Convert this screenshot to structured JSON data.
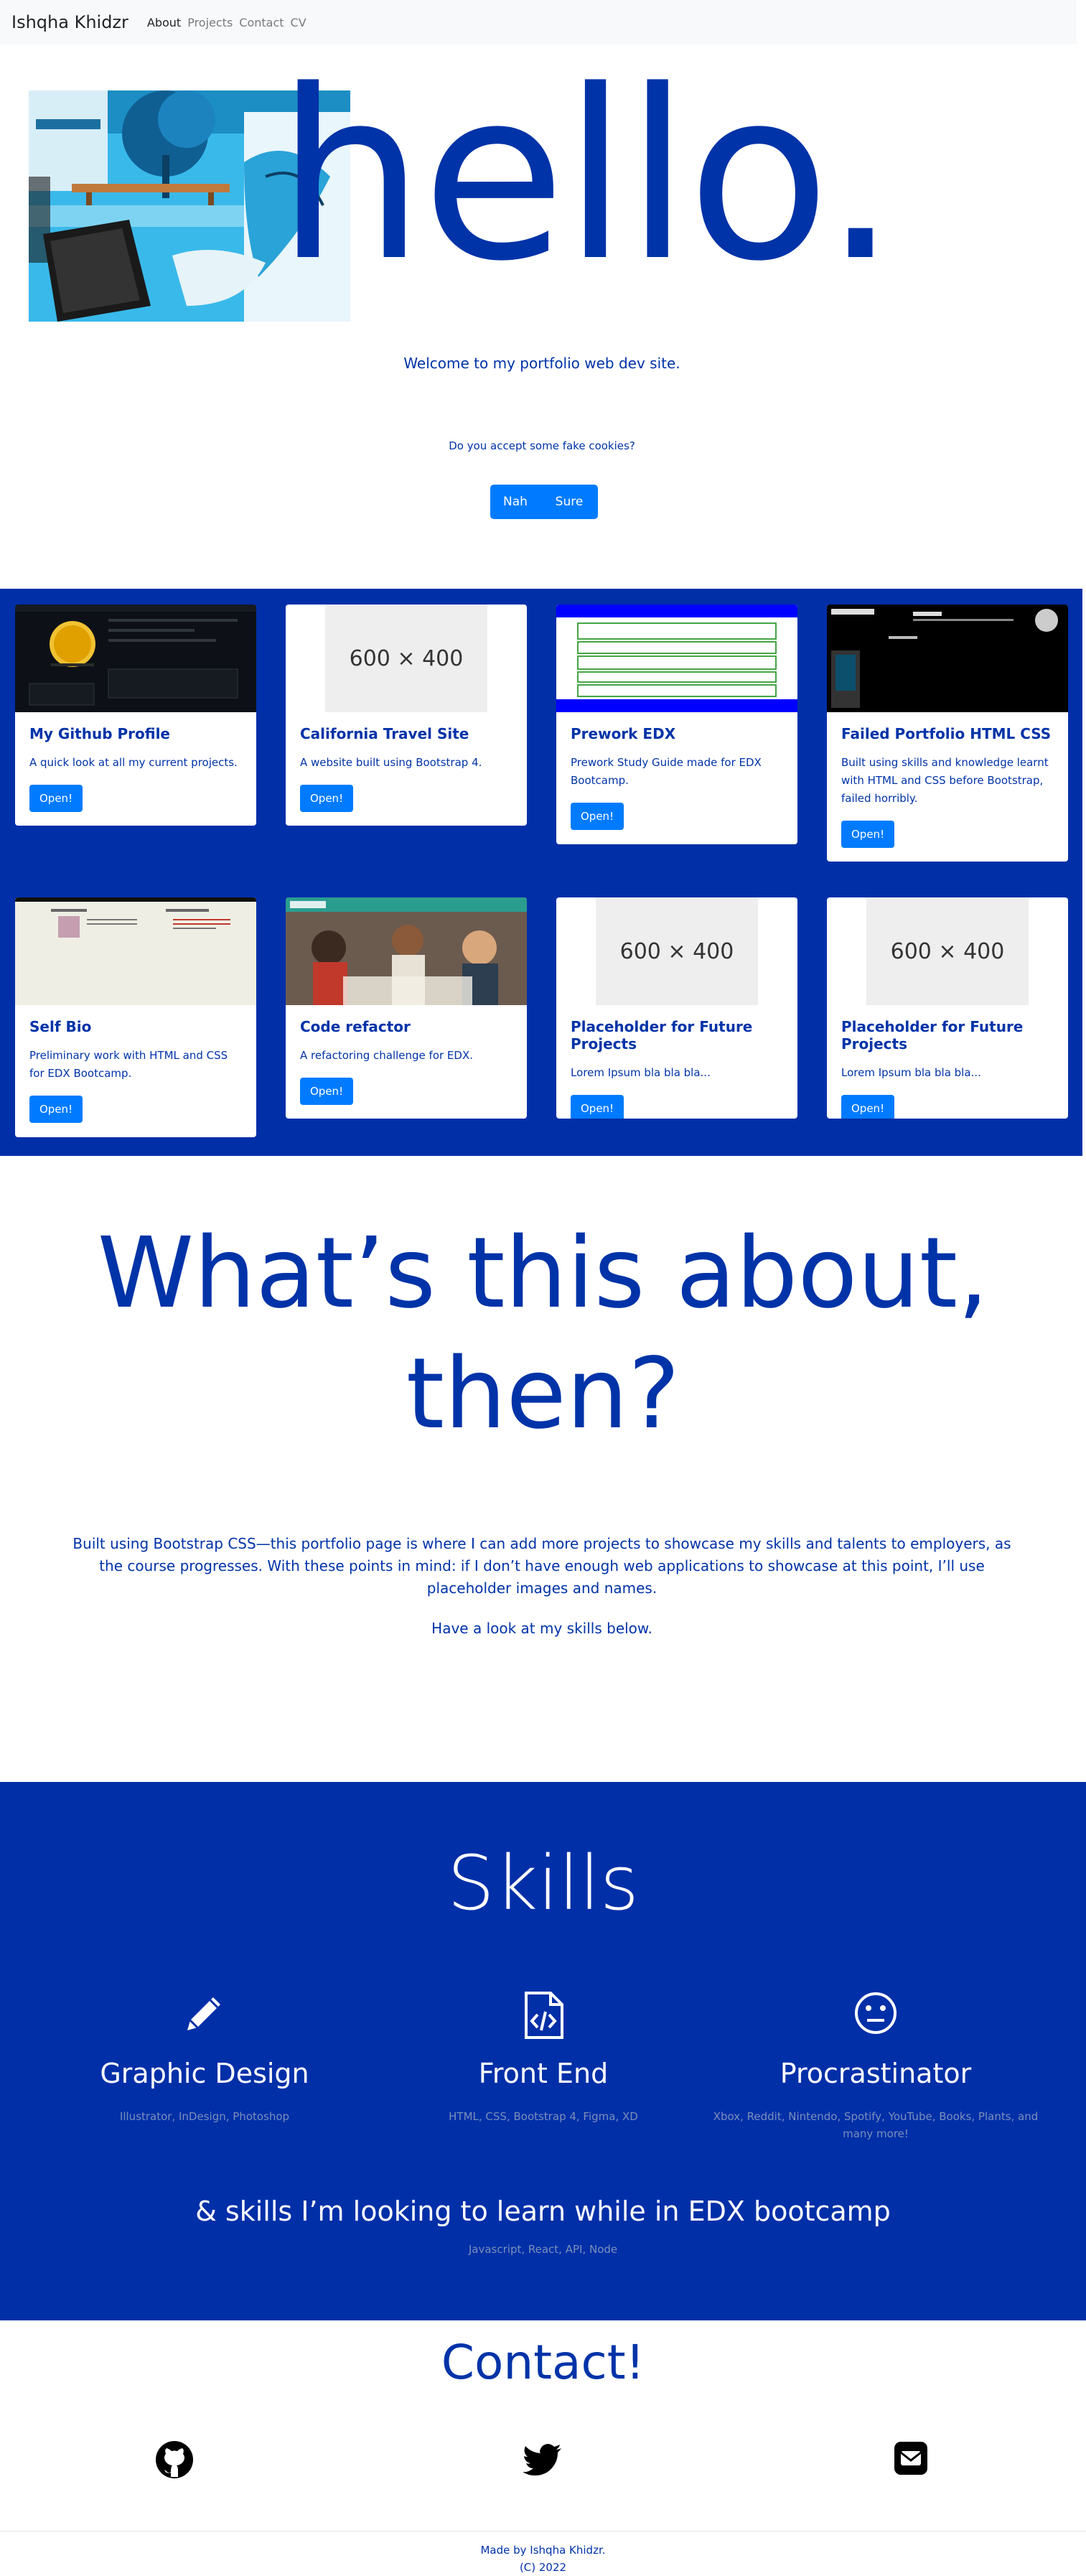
{
  "nav": {
    "brand": "Ishqha Khidzr",
    "links": [
      "About",
      "Projects",
      "Contact",
      "CV"
    ]
  },
  "hero": {
    "title": "hello.",
    "welcome": "Welcome to my portfolio web dev site.",
    "cookie_question": "Do you accept some fake cookies?",
    "nah_label": "Nah",
    "sure_label": "Sure"
  },
  "projects": [
    {
      "title": "My Github Profile",
      "text": "A quick look at all my current projects.",
      "button": "Open!",
      "image": "github-screenshot"
    },
    {
      "title": "California Travel Site",
      "text": "A website built using Bootstrap 4.",
      "button": "Open!",
      "image": "placeholder",
      "placeholder_text": "600 × 400"
    },
    {
      "title": "Prework EDX",
      "text": "Prework Study Guide made for EDX Bootcamp.",
      "button": "Open!",
      "image": "prework-screenshot"
    },
    {
      "title": "Failed Portfolio HTML CSS",
      "text": "Built using skills and knowledge learnt with HTML and CSS before Bootstrap, failed horribly.",
      "button": "Open!",
      "image": "failed-portfolio-screenshot"
    },
    {
      "title": "Self Bio",
      "text": "Preliminary work with HTML and CSS for EDX Bootcamp.",
      "button": "Open!",
      "image": "self-bio-screenshot"
    },
    {
      "title": "Code refactor",
      "text": "A refactoring challenge for EDX.",
      "button": "Open!",
      "image": "horiseon-screenshot"
    },
    {
      "title": "Placeholder for Future Projects",
      "text": "Lorem Ipsum bla bla bla...",
      "button": "Open!",
      "image": "placeholder",
      "placeholder_text": "600 × 400"
    },
    {
      "title": "Placeholder for Future Projects",
      "text": "Lorem Ipsum bla bla bla...",
      "button": "Open!",
      "image": "placeholder",
      "placeholder_text": "600 × 400"
    }
  ],
  "about": {
    "heading": "What’s this about, then?",
    "paragraph": "Built using Bootstrap CSS—this portfolio page is where I can add more projects to showcase my skills and talents to employers, as the course progresses. With these points in mind: if I don’t have enough web applications to showcase at this point, I’ll use placeholder images and names.",
    "skills_prompt": "Have a look at my skills below."
  },
  "skills": {
    "heading": "Skills",
    "items": [
      {
        "icon": "pencil-icon",
        "title": "Graphic Design",
        "sub": "Illustrator, InDesign, Photoshop"
      },
      {
        "icon": "code-file-icon",
        "title": "Front End",
        "sub": "HTML, CSS, Bootstrap 4, Figma, XD"
      },
      {
        "icon": "neutral-face-icon",
        "title": "Procrastinator",
        "sub": "Xbox, Reddit, Nintendo, Spotify, YouTube, Books, Plants, and many more!"
      }
    ],
    "learn_heading": "& skills I’m looking to learn while in EDX bootcamp",
    "learn_sub": "Javascript, React, API, Node"
  },
  "contact": {
    "heading": "Contact!",
    "icons": [
      "github-icon",
      "twitter-icon",
      "email-icon"
    ]
  },
  "footer": {
    "made_by": "Made by Ishqha Khidzr.",
    "copyright": "(C) 2022"
  },
  "colors": {
    "primary_blue": "#002fa8",
    "text_blue": "#0033a8",
    "button_blue": "#007bff"
  }
}
